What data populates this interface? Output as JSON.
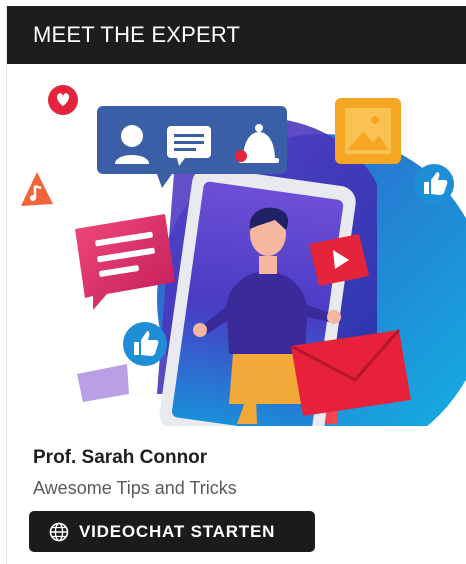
{
  "header": {
    "title": "MEET THE EXPERT"
  },
  "illustration": {
    "icons": [
      "heart-icon",
      "music-note-icon",
      "user-icon",
      "chat-message-icon",
      "bell-icon",
      "image-icon",
      "thumbs-up-icon",
      "play-icon",
      "envelope-icon"
    ]
  },
  "expert": {
    "name": "Prof. Sarah Connor",
    "tagline": "Awesome Tips and Tricks"
  },
  "action": {
    "button_label": "VIDEOCHAT STARTEN",
    "icon": "globe-icon"
  },
  "colors": {
    "header_bg": "#1d1d1d",
    "button_bg": "#1b1b1b",
    "accent_blue": "#1e8fd6",
    "accent_red": "#e3243b"
  }
}
